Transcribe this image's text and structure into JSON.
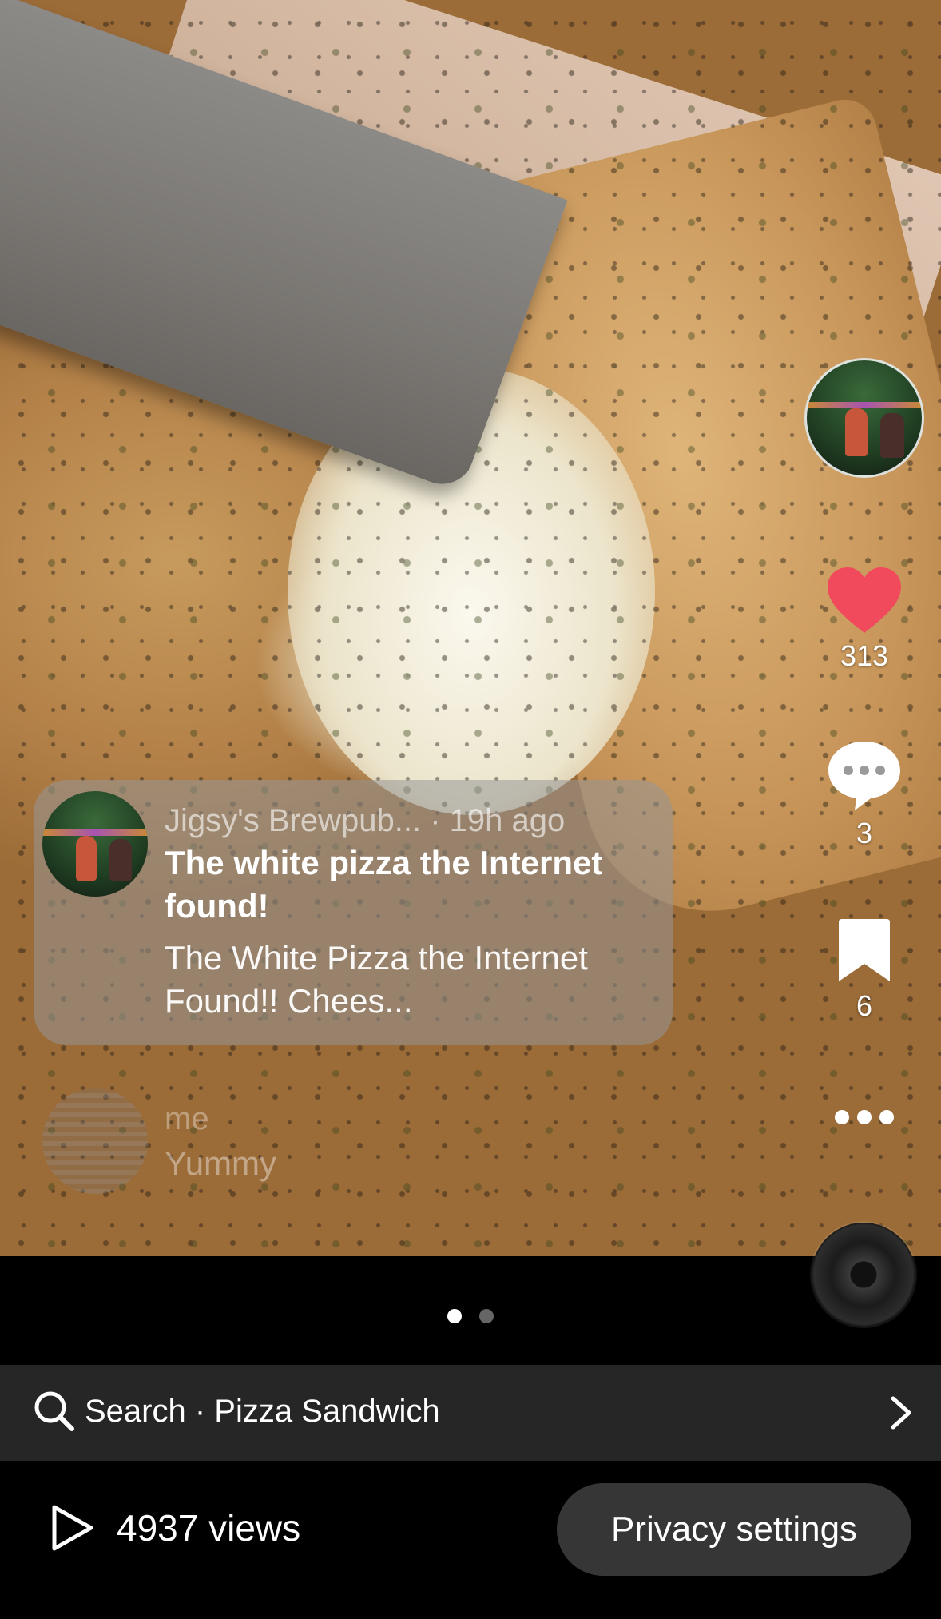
{
  "post": {
    "author": "Jigsy's Brewpub...",
    "time": "· 19h ago",
    "title": "The white pizza the Internet found!",
    "description": "The White Pizza the Internet Found!! Chees..."
  },
  "actions": {
    "likes": "313",
    "comments": "3",
    "saves": "6",
    "like_color": "#f04a5c"
  },
  "faded_item": {
    "name": "me",
    "text": "Yummy"
  },
  "pagination": {
    "total": 2,
    "active": 1
  },
  "search": {
    "label": "Search · Pizza Sandwich"
  },
  "footer": {
    "views": "4937 views",
    "privacy_label": "Privacy settings"
  }
}
